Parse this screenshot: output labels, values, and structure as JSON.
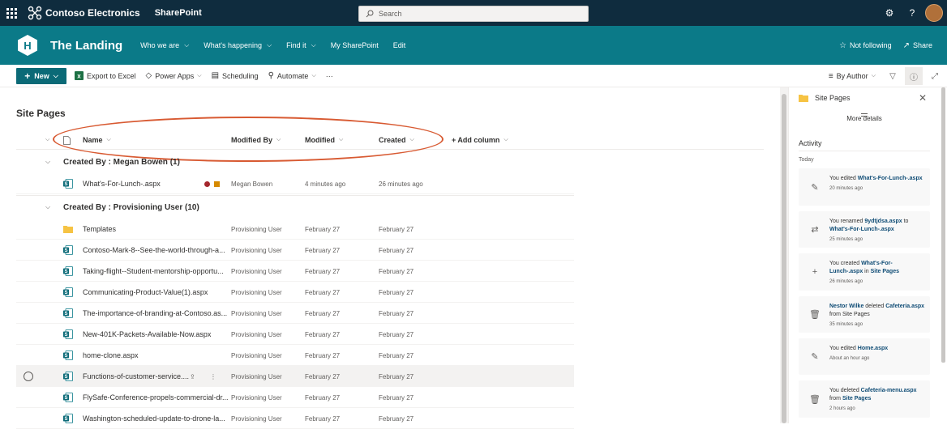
{
  "suite": {
    "brand": "Contoso Electronics",
    "app": "SharePoint",
    "search_placeholder": "Search",
    "settings_icon": "gear-icon",
    "help_icon": "question-icon"
  },
  "site": {
    "logo_letter": "H",
    "title": "The Landing",
    "nav": [
      {
        "label": "Who we are"
      },
      {
        "label": "What's happening"
      },
      {
        "label": "Find it"
      },
      {
        "label": "My SharePoint"
      },
      {
        "label": "Edit"
      }
    ],
    "not_following": "Not following",
    "share": "Share"
  },
  "commands": {
    "new": "New",
    "export": "Export to Excel",
    "power_apps": "Power Apps",
    "scheduling": "Scheduling",
    "automate": "Automate",
    "more": "···",
    "view": "By Author"
  },
  "list": {
    "title": "Site Pages",
    "columns": {
      "name": "Name",
      "modified_by": "Modified By",
      "modified": "Modified",
      "created": "Created",
      "add_column": "+ Add column"
    },
    "groups": [
      {
        "label": "Created By : Megan Bowen (1)"
      },
      {
        "label": "Created By : Provisioning User (10)"
      }
    ],
    "rows": [
      {
        "name": "What's-For-Lunch-.aspx",
        "modified_by": "Megan Bowen",
        "modified": "4 minutes ago",
        "created": "26 minutes ago",
        "type": "page"
      },
      {
        "name": "Templates",
        "modified_by": "Provisioning User",
        "modified": "February 27",
        "created": "February 27",
        "type": "folder"
      },
      {
        "name": "Contoso-Mark-8--See-the-world-through-a...",
        "modified_by": "Provisioning User",
        "modified": "February 27",
        "created": "February 27",
        "type": "page"
      },
      {
        "name": "Taking-flight--Student-mentorship-opportu...",
        "modified_by": "Provisioning User",
        "modified": "February 27",
        "created": "February 27",
        "type": "page"
      },
      {
        "name": "Communicating-Product-Value(1).aspx",
        "modified_by": "Provisioning User",
        "modified": "February 27",
        "created": "February 27",
        "type": "page"
      },
      {
        "name": "The-importance-of-branding-at-Contoso.as...",
        "modified_by": "Provisioning User",
        "modified": "February 27",
        "created": "February 27",
        "type": "page"
      },
      {
        "name": "New-401K-Packets-Available-Now.aspx",
        "modified_by": "Provisioning User",
        "modified": "February 27",
        "created": "February 27",
        "type": "page"
      },
      {
        "name": "home-clone.aspx",
        "modified_by": "Provisioning User",
        "modified": "February 27",
        "created": "February 27",
        "type": "page"
      },
      {
        "name": "Functions-of-customer-service....",
        "modified_by": "Provisioning User",
        "modified": "February 27",
        "created": "February 27",
        "type": "page"
      },
      {
        "name": "FlySafe-Conference-propels-commercial-dr...",
        "modified_by": "Provisioning User",
        "modified": "February 27",
        "created": "February 27",
        "type": "page"
      },
      {
        "name": "Washington-scheduled-update-to-drone-la...",
        "modified_by": "Provisioning User",
        "modified": "February 27",
        "created": "February 27",
        "type": "page"
      }
    ]
  },
  "pane": {
    "title": "Site Pages",
    "more_details": "More details",
    "activity": "Activity",
    "today": "Today",
    "cards": [
      {
        "icon": "pencil-icon",
        "parts": [
          "You edited ",
          "What's-For-Lunch-.aspx"
        ],
        "time": "20 minutes ago"
      },
      {
        "icon": "rename-icon",
        "parts": [
          "You renamed ",
          "9ydtjdsa.aspx",
          " to ",
          "What's-For-Lunch-.aspx"
        ],
        "time": "25 minutes ago"
      },
      {
        "icon": "plus-icon",
        "parts": [
          "You created ",
          "What's-For-Lunch-.aspx",
          " in ",
          "Site Pages"
        ],
        "time": "26 minutes ago"
      },
      {
        "icon": "trash-icon",
        "parts": [
          "Nestor Wilke",
          " deleted ",
          "Cafeteria.aspx",
          " from Site Pages"
        ],
        "time": "35 minutes ago"
      },
      {
        "icon": "pencil-icon",
        "parts": [
          "You edited ",
          "Home.aspx"
        ],
        "time": "About an hour ago"
      },
      {
        "icon": "trash-icon",
        "parts": [
          "You deleted ",
          "Cafeteria-menu.aspx",
          " from ",
          "Site Pages"
        ],
        "time": "2 hours ago"
      }
    ]
  },
  "colors": {
    "suite_bar": "#0f2c3e",
    "site_header": "#0b7a88",
    "new_button": "#0b6a77",
    "annotation_oval": "#d85a32",
    "link": "#0f4c75"
  }
}
